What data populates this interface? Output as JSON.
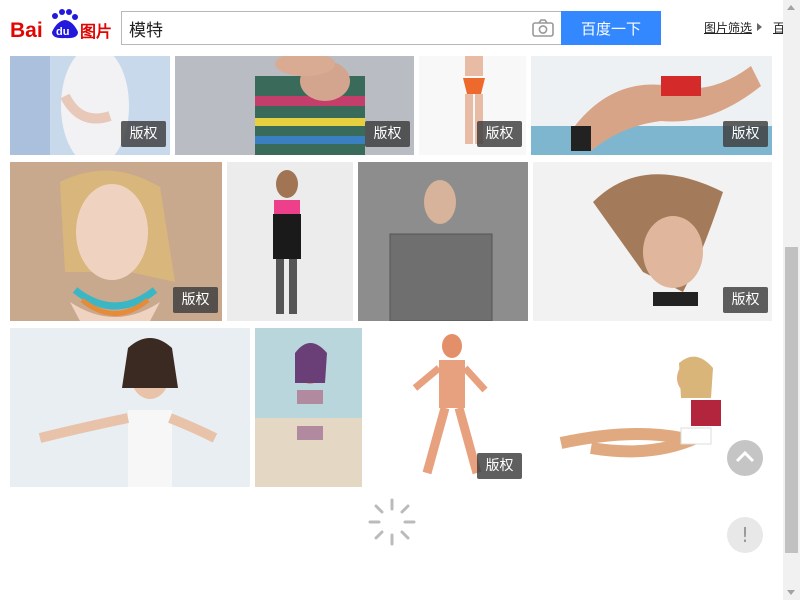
{
  "header": {
    "logo_text": "Bai du 图片",
    "search_query": "模特",
    "search_button_label": "百度一下",
    "filter_label": "图片筛选",
    "more_label": "百"
  },
  "badges": {
    "copyright": "版权"
  },
  "help_label": "!"
}
